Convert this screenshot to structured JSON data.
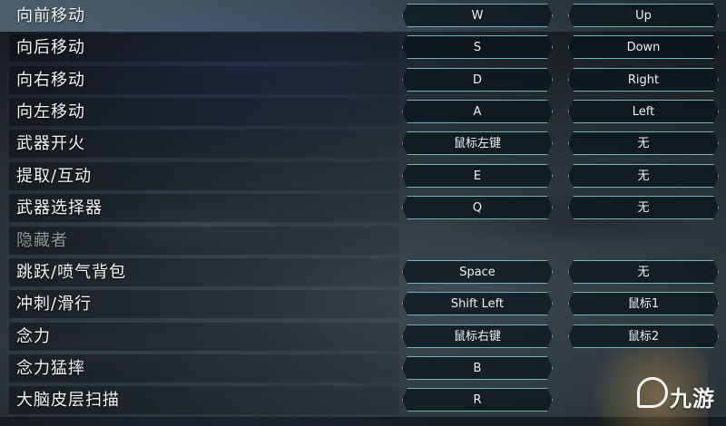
{
  "bindings": [
    {
      "action": "向前移动",
      "primary": "W",
      "secondary": "Up",
      "highlight": true
    },
    {
      "action": "向后移动",
      "primary": "S",
      "secondary": "Down"
    },
    {
      "action": "向右移动",
      "primary": "D",
      "secondary": "Right"
    },
    {
      "action": "向左移动",
      "primary": "A",
      "secondary": "Left"
    },
    {
      "action": "武器开火",
      "primary": "鼠标左键",
      "secondary": "无"
    },
    {
      "action": "提取/互动",
      "primary": "E",
      "secondary": "无"
    },
    {
      "action": "武器选择器",
      "primary": "Q",
      "secondary": "无"
    },
    {
      "action": "隐藏者",
      "disabled": true
    },
    {
      "action": "跳跃/喷气背包",
      "primary": "Space",
      "secondary": "无"
    },
    {
      "action": "冲刺/滑行",
      "primary": "Shift Left",
      "secondary": "鼠标1"
    },
    {
      "action": "念力",
      "primary": "鼠标右键",
      "secondary": "鼠标2"
    },
    {
      "action": "念力猛摔",
      "primary": "B"
    },
    {
      "action": "大脑皮层扫描",
      "primary": "R"
    }
  ],
  "watermark": {
    "text": "九游",
    "icon": "j-logo-icon"
  },
  "colors": {
    "key_border": "#6fb5b9",
    "highlight": "#7896aa",
    "disabled_text": "#8e9aa0"
  }
}
